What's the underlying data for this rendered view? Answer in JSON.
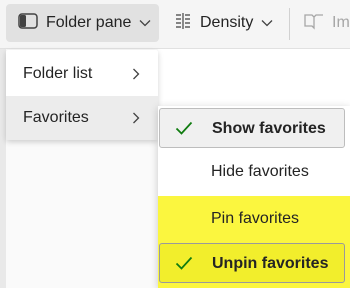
{
  "toolbar": {
    "folder_pane_label": "Folder pane",
    "density_label": "Density",
    "immersive_label": "Im"
  },
  "folder_pane_menu": {
    "items": [
      {
        "label": "Folder list",
        "icon": "chevron-right-icon"
      },
      {
        "label": "Favorites",
        "icon": "chevron-right-icon",
        "hovered": true
      }
    ]
  },
  "favorites_submenu": {
    "items": [
      {
        "label": "Show favorites",
        "checked": true
      },
      {
        "label": "Hide favorites",
        "checked": false
      },
      {
        "label": "Pin favorites",
        "checked": false
      },
      {
        "label": "Unpin favorites",
        "checked": true
      }
    ],
    "highlight_color": "#fbf63f",
    "check_color": "#107c10"
  }
}
